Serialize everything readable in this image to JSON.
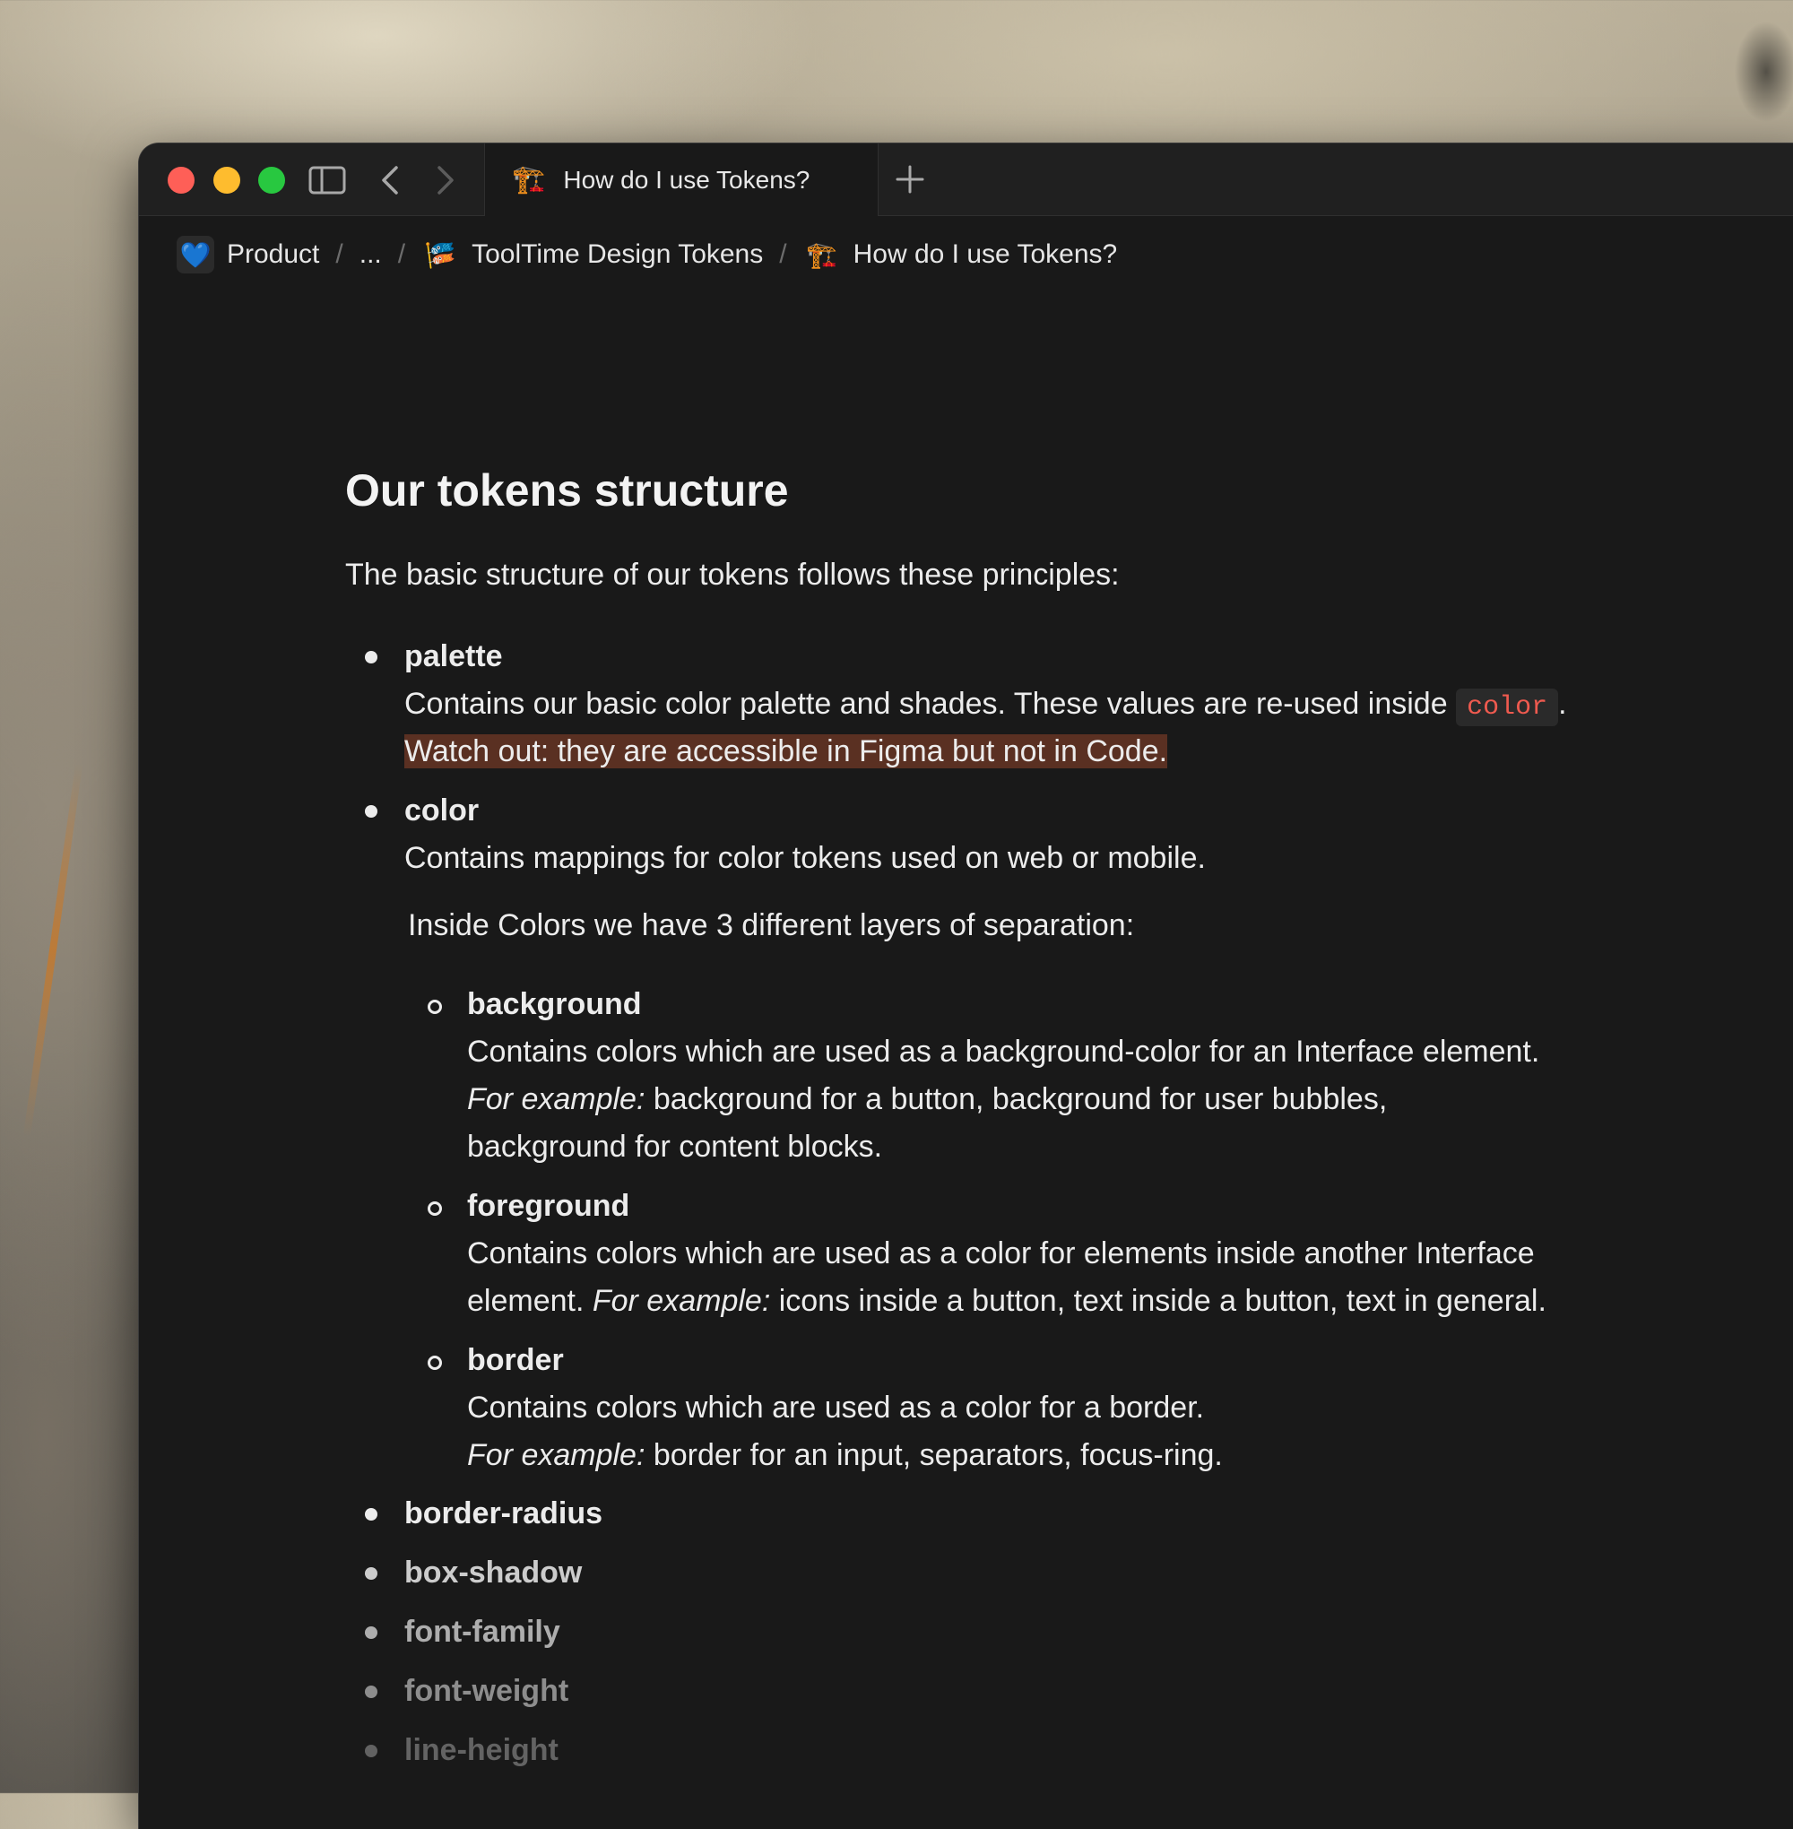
{
  "tab": {
    "emoji": "🏗️",
    "title": "How do I use Tokens?"
  },
  "breadcrumb": {
    "items": [
      {
        "emoji": "💙",
        "label": "Product"
      },
      {
        "emoji": "",
        "label": "..."
      },
      {
        "emoji": "🎏",
        "label": "ToolTime Design Tokens"
      },
      {
        "emoji": "🏗️",
        "label": "How do I use Tokens?"
      }
    ],
    "separator": "/"
  },
  "doc": {
    "heading": "Our tokens structure",
    "intro": "The basic structure of our tokens follows these principles:",
    "palette": {
      "title": "palette",
      "desc_before": "Contains our basic color palette and shades. These values are re-used inside ",
      "code": "color",
      "desc_after": ".",
      "warning": "Watch out: they are accessible in Figma but not in Code."
    },
    "color": {
      "title": "color",
      "desc": "Contains mappings for color tokens used on web or mobile.",
      "note": "Inside Colors we have 3 different layers of separation:",
      "background": {
        "title": "background",
        "line1": "Contains colors which are used as a background-color for an Interface element.",
        "example_label": "For example:",
        "line2": " background for a button, background for user bubbles,",
        "line3": "background for content blocks."
      },
      "foreground": {
        "title": "foreground",
        "line1": "Contains colors which are used as a color for elements inside another Interface",
        "line2_before": "element. ",
        "example_label": "For example:",
        "line2_after": " icons inside a button, text inside a button, text in general."
      },
      "border": {
        "title": "border",
        "line1": "Contains colors which are used as a color for a border.",
        "example_label": "For example:",
        "line2": " border for an input, separators, focus-ring."
      }
    },
    "more": [
      "border-radius",
      "box-shadow",
      "font-family",
      "font-weight",
      "line-height"
    ]
  }
}
